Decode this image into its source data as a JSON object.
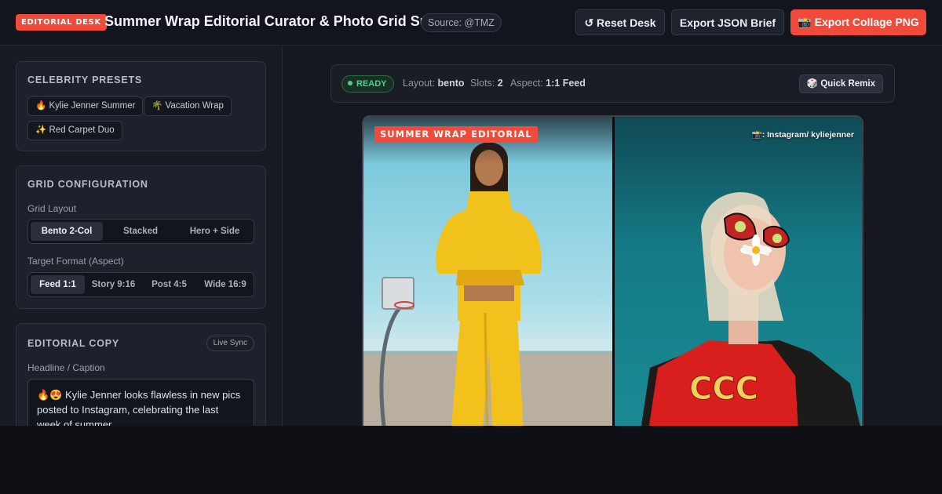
{
  "header": {
    "badge": "EDITORIAL DESK",
    "title": "Summer Wrap Editorial Curator & Photo Grid Suite",
    "source": "Source: @TMZ",
    "reset_label": "↺ Reset Desk",
    "json_label": "Export JSON Brief",
    "png_label": "📸 Export Collage PNG"
  },
  "sidebar": {
    "presets": {
      "title": "CELEBRITY PRESETS",
      "chips": [
        "🔥 Kylie Jenner Summer",
        "🌴 Vacation Wrap",
        "✨ Red Carpet Duo"
      ]
    },
    "grid": {
      "title": "GRID CONFIGURATION",
      "layout_label": "Grid Layout",
      "layouts": [
        "Bento 2-Col",
        "Stacked",
        "Hero + Side"
      ],
      "layout_selected": "Bento 2-Col",
      "aspect_label": "Target Format (Aspect)",
      "aspects": [
        "Feed 1:1",
        "Story 9:16",
        "Post 4:5",
        "Wide 16:9"
      ],
      "aspect_selected": "Feed 1:1"
    },
    "copy": {
      "title": "EDITORIAL COPY",
      "live": "Live Sync",
      "headline_label": "Headline / Caption",
      "headline_value": "🔥😍 Kylie Jenner looks flawless in new pics posted to Instagram, celebrating the last week of summer."
    }
  },
  "status": {
    "ready": "READY",
    "layout_key": "Layout:",
    "layout_val": "bento",
    "slots_key": "Slots:",
    "slots_val": "2",
    "aspect_key": "Aspect:",
    "aspect_val": "1:1 Feed",
    "remix_label": "🎲 Quick Remix"
  },
  "collage": {
    "overlay": "SUMMER WRAP EDITORIAL",
    "credit": "📸: Instagram/ kyliejenner"
  },
  "colors": {
    "accent": "#ef4a3a",
    "ready": "#4fd08a",
    "background": "#151821"
  }
}
